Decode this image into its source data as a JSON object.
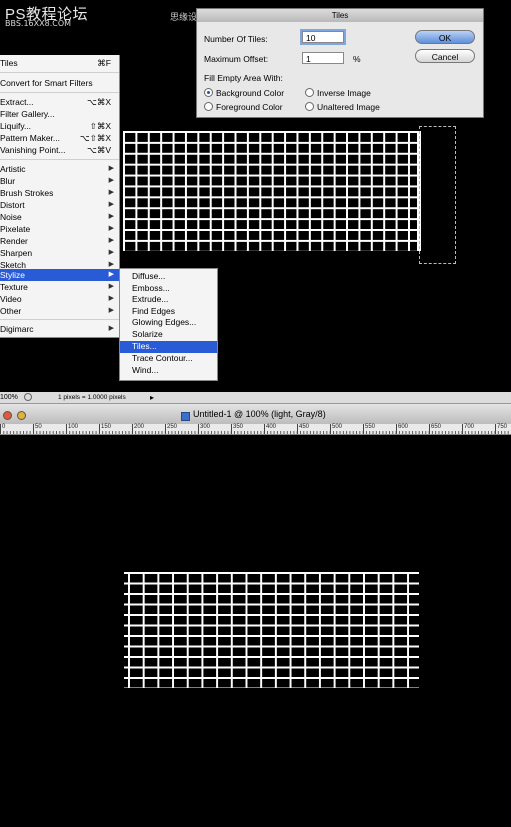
{
  "watermark": {
    "title": "PS教程论坛",
    "url": "BBS.16XX8.COM",
    "right": "思缘设计论坛 WWW.MISSYUAN.COM"
  },
  "filter_menu": {
    "items": [
      {
        "label": "Tiles",
        "shortcut": "⌘F",
        "arrow": false
      },
      {
        "label": "Convert for Smart Filters",
        "shortcut": "",
        "arrow": false
      },
      {
        "label": "Extract...",
        "shortcut": "⌥⌘X",
        "arrow": false
      },
      {
        "label": "Filter Gallery...",
        "shortcut": "",
        "arrow": false
      },
      {
        "label": "Liquify...",
        "shortcut": "⇧⌘X",
        "arrow": false
      },
      {
        "label": "Pattern Maker...",
        "shortcut": "⌥⇧⌘X",
        "arrow": false
      },
      {
        "label": "Vanishing Point...",
        "shortcut": "⌥⌘V",
        "arrow": false
      },
      {
        "label": "Artistic",
        "shortcut": "",
        "arrow": true
      },
      {
        "label": "Blur",
        "shortcut": "",
        "arrow": true
      },
      {
        "label": "Brush Strokes",
        "shortcut": "",
        "arrow": true
      },
      {
        "label": "Distort",
        "shortcut": "",
        "arrow": true
      },
      {
        "label": "Noise",
        "shortcut": "",
        "arrow": true
      },
      {
        "label": "Pixelate",
        "shortcut": "",
        "arrow": true
      },
      {
        "label": "Render",
        "shortcut": "",
        "arrow": true
      },
      {
        "label": "Sharpen",
        "shortcut": "",
        "arrow": true
      },
      {
        "label": "Sketch",
        "shortcut": "",
        "arrow": true
      },
      {
        "label": "Stylize",
        "shortcut": "",
        "arrow": true
      },
      {
        "label": "Texture",
        "shortcut": "",
        "arrow": true
      },
      {
        "label": "Video",
        "shortcut": "",
        "arrow": true
      },
      {
        "label": "Other",
        "shortcut": "",
        "arrow": true
      },
      {
        "label": "Digimarc",
        "shortcut": "",
        "arrow": true
      }
    ]
  },
  "stylize_submenu": {
    "items": [
      "Diffuse...",
      "Emboss...",
      "Extrude...",
      "Find Edges",
      "Glowing Edges...",
      "Solarize",
      "Tiles...",
      "Trace Contour...",
      "Wind..."
    ],
    "selected": "Tiles..."
  },
  "tiles_dialog": {
    "title": "Tiles",
    "number_of_tiles_label": "Number Of Tiles:",
    "number_of_tiles_value": "10",
    "max_offset_label": "Maximum Offset:",
    "max_offset_value": "1",
    "percent": "%",
    "fill_label": "Fill Empty Area With:",
    "options": [
      "Background Color",
      "Foreground Color",
      "Inverse Image",
      "Unaltered Image"
    ],
    "selected_option": "Background Color",
    "ok_label": "OK",
    "cancel_label": "Cancel"
  },
  "status_bar": {
    "zoom": "100%",
    "info": "1 pixels = 1.0000 pixels",
    "nav_arrow": "▸"
  },
  "document_window": {
    "title": "Untitled-1 @ 100% (light, Gray/8)"
  },
  "ruler": {
    "labels": [
      "0",
      "50",
      "100",
      "150",
      "200",
      "250",
      "300",
      "350",
      "400",
      "450",
      "500",
      "550",
      "600",
      "650",
      "700",
      "750"
    ]
  },
  "colors": {
    "menu_highlight": "#2a5bd7",
    "canvas": "#000000",
    "grid": "#ffffff"
  }
}
